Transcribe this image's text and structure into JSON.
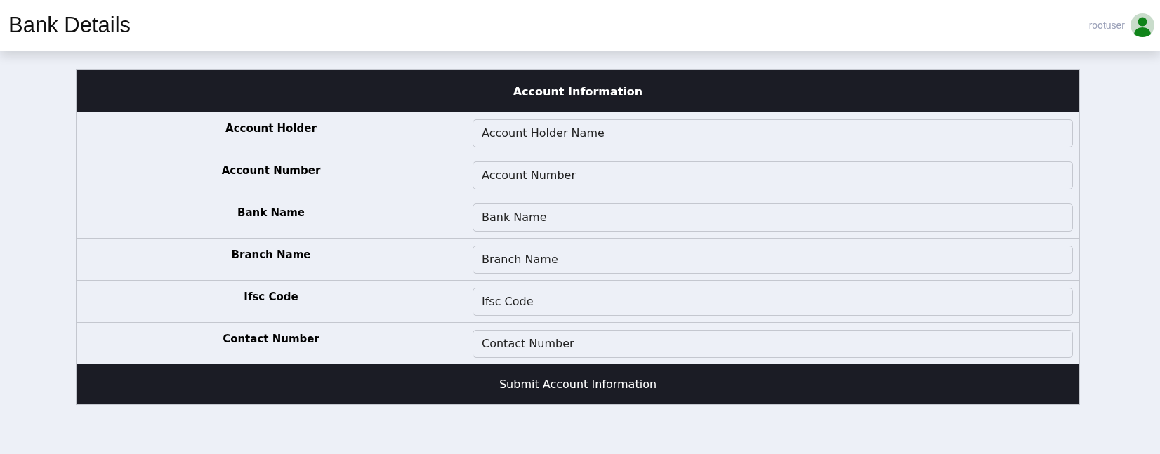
{
  "header": {
    "title": "Bank Details",
    "user": "rootuser"
  },
  "form": {
    "title": "Account Information",
    "fields": [
      {
        "label": "Account Holder",
        "placeholder": "Account Holder Name"
      },
      {
        "label": "Account Number",
        "placeholder": "Account Number"
      },
      {
        "label": "Bank Name",
        "placeholder": "Bank Name"
      },
      {
        "label": "Branch Name",
        "placeholder": "Branch Name"
      },
      {
        "label": "Ifsc Code",
        "placeholder": "Ifsc Code"
      },
      {
        "label": "Contact Number",
        "placeholder": "Contact Number"
      }
    ],
    "submit": "Submit Account Information"
  }
}
